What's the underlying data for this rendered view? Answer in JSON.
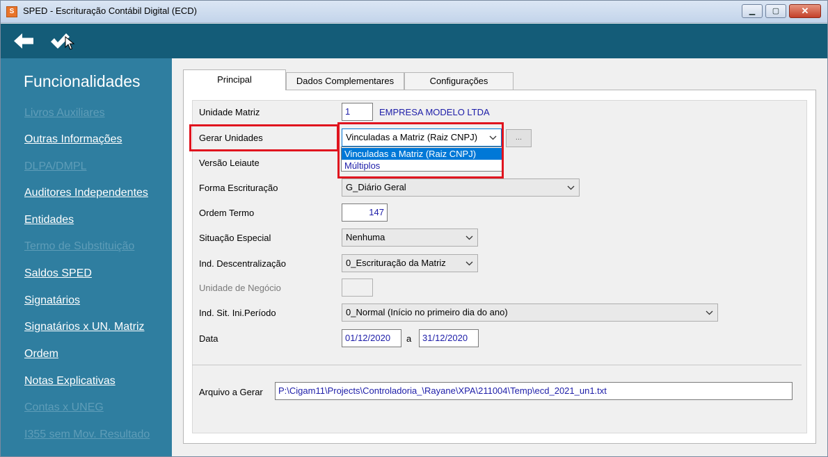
{
  "window": {
    "title": "SPED - Escrituração Contábil Digital (ECD)",
    "app_icon": "sped-app-icon",
    "controls": {
      "minimize": "▁",
      "maximize": "▢",
      "close": "✕"
    }
  },
  "toolbar": {
    "back_icon": "arrow-left-icon",
    "confirm_icon": "checkmark-icon"
  },
  "sidebar": {
    "title": "Funcionalidades",
    "items": [
      {
        "label": "Livros Auxiliares",
        "enabled": false
      },
      {
        "label": "Outras Informações",
        "enabled": true
      },
      {
        "label": "DLPA/DMPL",
        "enabled": false
      },
      {
        "label": "Auditores Independentes",
        "enabled": true
      },
      {
        "label": "Entidades",
        "enabled": true
      },
      {
        "label": "Termo de Substituição",
        "enabled": false
      },
      {
        "label": "Saldos SPED",
        "enabled": true
      },
      {
        "label": "Signatários",
        "enabled": true
      },
      {
        "label": "Signatários x UN. Matriz",
        "enabled": true
      },
      {
        "label": "Ordem",
        "enabled": true
      },
      {
        "label": "Notas Explicativas",
        "enabled": true
      },
      {
        "label": "Contas x UNEG",
        "enabled": false
      },
      {
        "label": "I355 sem Mov. Resultado",
        "enabled": false
      }
    ]
  },
  "tabs": [
    {
      "label": "Principal",
      "active": true
    },
    {
      "label": "Dados Complementares",
      "active": false
    },
    {
      "label": "Configurações",
      "active": false
    }
  ],
  "form": {
    "unidade_matriz": {
      "label": "Unidade Matriz",
      "value": "1",
      "name": "EMPRESA MODELO LTDA"
    },
    "gerar_unidades": {
      "label": "Gerar Unidades",
      "value": "Vinculadas a Matriz (Raiz CNPJ)",
      "button": "...",
      "options": [
        "Vinculadas a Matriz (Raiz CNPJ)",
        "Múltiplos"
      ]
    },
    "versao_leiaute": {
      "label": "Versão Leiaute"
    },
    "forma_escrituracao": {
      "label": "Forma Escrituração",
      "value": "G_Diário Geral"
    },
    "ordem_termo": {
      "label": "Ordem Termo",
      "value": "147"
    },
    "situacao_especial": {
      "label": "Situação Especial",
      "value": "Nenhuma"
    },
    "ind_descentralizacao": {
      "label": "Ind. Descentralização",
      "value": "0_Escrituração da Matriz"
    },
    "unidade_negocio": {
      "label": "Unidade de Negócio",
      "value": ""
    },
    "ind_sit_ini_periodo": {
      "label": "Ind. Sit. Ini.Período",
      "value": "0_Normal (Início no primeiro dia do ano)"
    },
    "data": {
      "label": "Data",
      "from": "01/12/2020",
      "separator": "a",
      "to": "31/12/2020"
    },
    "arquivo": {
      "label": "Arquivo a Gerar",
      "value": "P:\\Cigam11\\Projects\\Controladoria_\\Rayane\\XPA\\211004\\Temp\\ecd_2021_un1.txt"
    }
  },
  "colors": {
    "toolbar": "#145c78",
    "sidebar": "#2f7ea0",
    "highlight": "#e0141e",
    "selection": "#0078d7"
  }
}
